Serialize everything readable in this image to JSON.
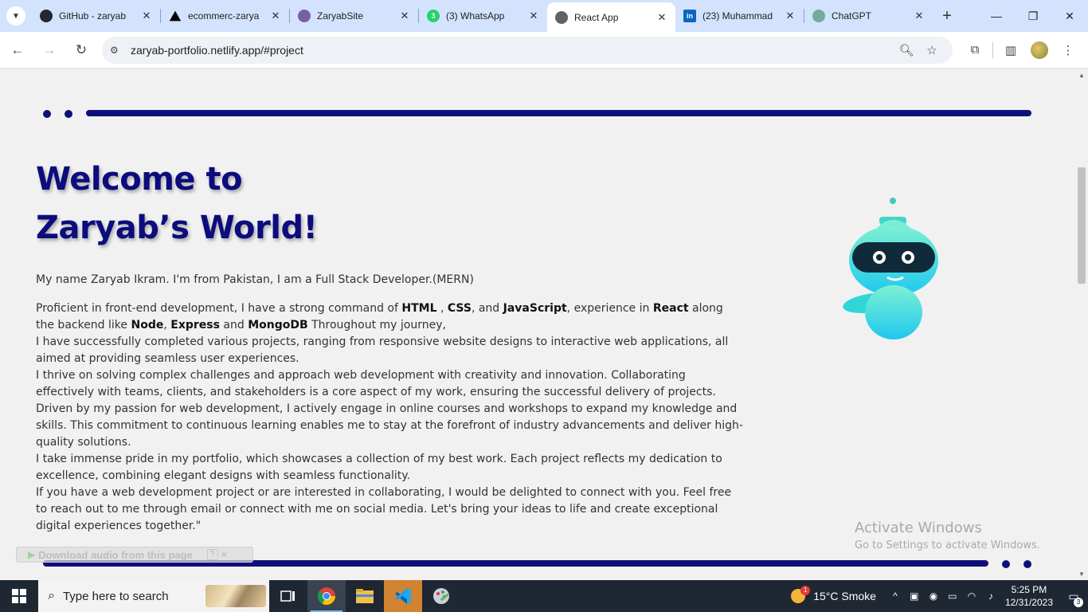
{
  "browser": {
    "tabs": [
      {
        "title": "GitHub - zaryab",
        "favicon": "github-icon",
        "color": "#24292f",
        "active": false
      },
      {
        "title": "ecommerc-zarya",
        "favicon": "vercel-icon",
        "color": "#000000",
        "active": false
      },
      {
        "title": "ZaryabSite",
        "favicon": "netlify-icon",
        "color": "#7b5ea7",
        "active": false
      },
      {
        "title": "(3) WhatsApp",
        "favicon": "whatsapp-icon",
        "color": "#25d366",
        "active": false
      },
      {
        "title": "React App",
        "favicon": "globe-icon",
        "color": "#5f6368",
        "active": true
      },
      {
        "title": "(23) Muhammad",
        "favicon": "linkedin-icon",
        "color": "#0a66c2",
        "active": false
      },
      {
        "title": "ChatGPT",
        "favicon": "chatgpt-icon",
        "color": "#74aa9c",
        "active": false
      }
    ],
    "whatsapp_badge": "3",
    "url": "zaryab-portfolio.netlify.app/#project"
  },
  "hero": {
    "title_line1": "Welcome to",
    "title_line2": "Zaryab’s World!",
    "intro": "My name Zaryab Ikram. I'm from Pakistan, I am a Full Stack Developer.(MERN)",
    "bio": {
      "p1_a": "Proficient in front-end development, I have a strong command of ",
      "html": "HTML",
      "p1_b": " , ",
      "css": "CSS",
      "p1_c": ", and ",
      "js": "JavaScript",
      "p1_d": ", experience in ",
      "react": "React",
      "p1_e": " along the backend like ",
      "node": "Node",
      "p1_f": ", ",
      "express": "Express",
      "p1_g": " and ",
      "mongo": "MongoDB",
      "p1_h": " Throughout my journey,",
      "p2": "I have successfully completed various projects, ranging from responsive website designs to interactive web applications, all aimed at providing seamless user experiences.",
      "p3": "I thrive on solving complex challenges and approach web development with creativity and innovation. Collaborating effectively with teams, clients, and stakeholders is a core aspect of my work, ensuring the successful delivery of projects.",
      "p4": "Driven by my passion for web development, I actively engage in online courses and workshops to expand my knowledge and skills. This commitment to continuous learning enables me to stay at the forefront of industry advancements and deliver high-quality solutions.",
      "p5": "I take immense pride in my portfolio, which showcases a collection of my best work. Each project reflects my dedication to excellence, combining elegant designs with seamless functionality.",
      "p6": "If you have a web development project or are interested in collaborating, I would be delighted to connect with you. Feel free to reach out to me through email or connect with me on social media. Let's bring your ideas to life and create exceptional digital experiences together.\""
    }
  },
  "extension": {
    "label": "Download audio from this page",
    "help": "?",
    "close": "×"
  },
  "watermark": {
    "line1": "Activate Windows",
    "line2": "Go to Settings to activate Windows."
  },
  "taskbar": {
    "search_placeholder": "Type here to search",
    "weather": "15°C  Smoke",
    "time": "5:25 PM",
    "date": "12/31/2023",
    "notifications": "3"
  },
  "colors": {
    "brand": "#0c0c7d",
    "tabstrip": "#d3e3fd"
  }
}
